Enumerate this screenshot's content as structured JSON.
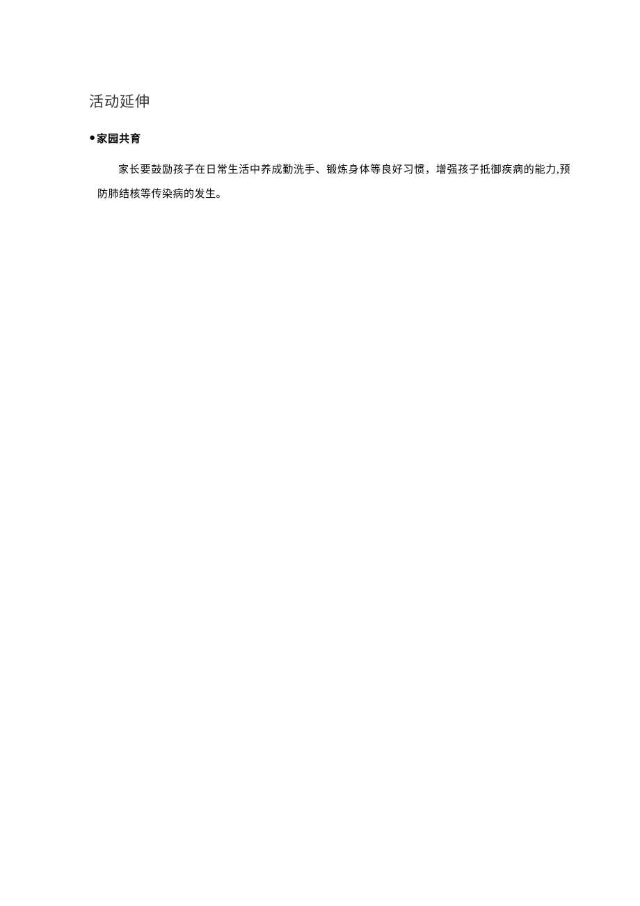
{
  "document": {
    "section_title": "活动延伸",
    "subsection": {
      "bullet": "●",
      "title": "家园共育",
      "body": "家长要鼓励孩子在日常生活中养成勤洗手、锻炼身体等良好习惯，增强孩子抵御疾病的能力,预防肺结核等传染病的发生。"
    }
  }
}
